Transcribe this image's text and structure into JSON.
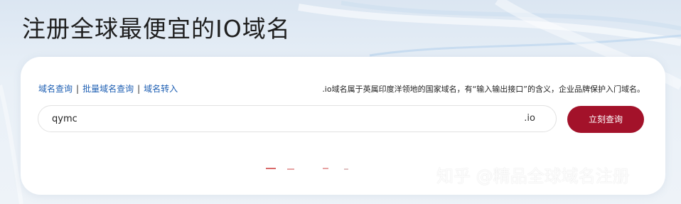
{
  "page": {
    "title": "注册全球最便宜的IO域名"
  },
  "nav": {
    "items": [
      "域名查询",
      "批量域名查询",
      "域名转入"
    ],
    "separator": "|"
  },
  "description": ".io域名属于英属印度洋领地的国家域名，有“输入输出接口”的含义，企业品牌保护入门域名。",
  "search": {
    "value": "qymc",
    "suffix": ".io"
  },
  "query_button": {
    "label": "立刻查询"
  },
  "watermark": "知乎 @精品全球域名注册",
  "colors": {
    "accent": "#a3122a",
    "link": "#1e5fb3"
  }
}
